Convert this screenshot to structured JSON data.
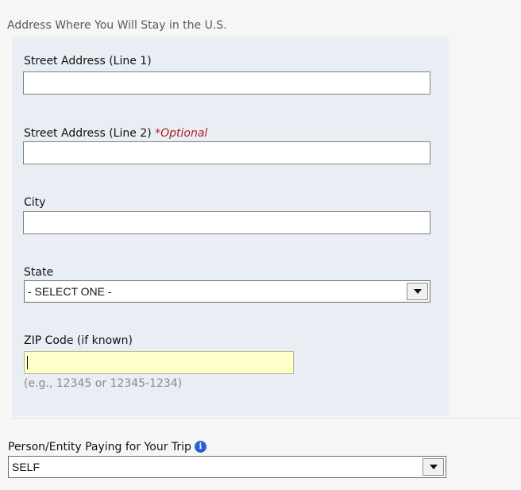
{
  "section": {
    "title": "Address Where You Will Stay in the U.S."
  },
  "fields": {
    "street1": {
      "label": "Street Address (Line 1)",
      "value": ""
    },
    "street2": {
      "label": "Street Address (Line 2)",
      "optional_label": "*Optional",
      "value": ""
    },
    "city": {
      "label": "City",
      "value": ""
    },
    "state": {
      "label": "State",
      "selected": "- SELECT ONE -"
    },
    "zip": {
      "label": "ZIP Code (if known)",
      "value": "",
      "hint": "(e.g., 12345 or 12345-1234)"
    }
  },
  "payer": {
    "label": "Person/Entity Paying for Your Trip",
    "selected": "SELF",
    "info_icon": "info-icon"
  },
  "colors": {
    "panel_background": "#e9eef5",
    "optional_text": "#b21d1d",
    "zip_focus_background": "#ffffc9",
    "info_icon": "#2d5fd0"
  }
}
